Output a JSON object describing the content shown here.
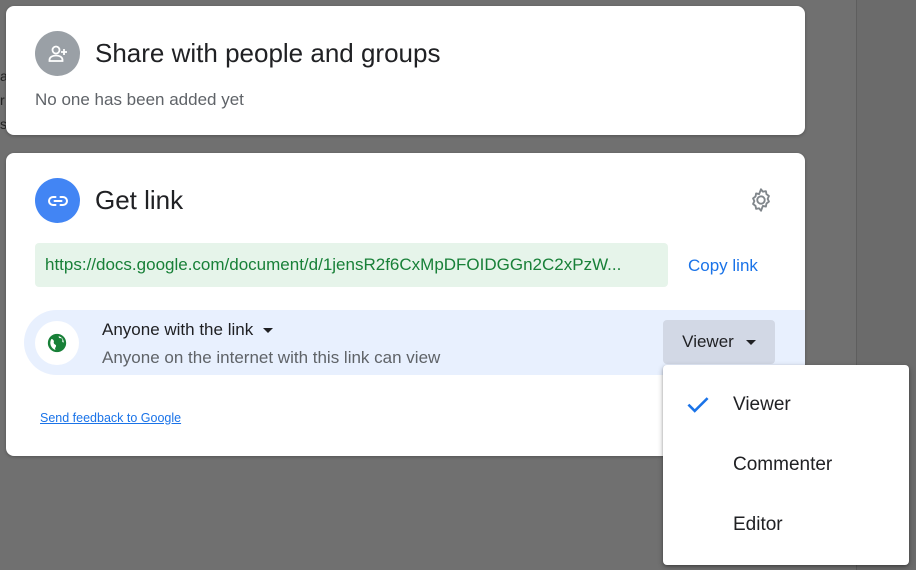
{
  "share_card": {
    "title": "Share with people and groups",
    "empty_message": "No one has been added yet",
    "avatar_icon": "add-person-icon"
  },
  "link_card": {
    "title": "Get link",
    "link_icon": "link-icon",
    "settings_icon": "gear-icon",
    "url": "https://docs.google.com/document/d/1jensR2f6CxMpDFOIDGGn2C2xPzW...",
    "copy_label": "Copy link",
    "access": {
      "title": "Anyone with the link",
      "description": "Anyone on the internet with this link can view",
      "icon": "globe-icon",
      "role_label": "Viewer"
    },
    "feedback_label": "Send feedback to Google"
  },
  "role_menu": {
    "items": [
      {
        "label": "Viewer",
        "selected": true
      },
      {
        "label": "Commenter",
        "selected": false
      },
      {
        "label": "Editor",
        "selected": false
      }
    ]
  },
  "background_fragments": [
    "a",
    "r",
    "s"
  ],
  "colors": {
    "accent": "#1a73e8",
    "link_green": "#188038",
    "link_bg": "#e6f4ea",
    "access_bg": "#e8f0fe",
    "avatar_blue": "#4285f4",
    "avatar_gray": "#9aa0a6"
  }
}
